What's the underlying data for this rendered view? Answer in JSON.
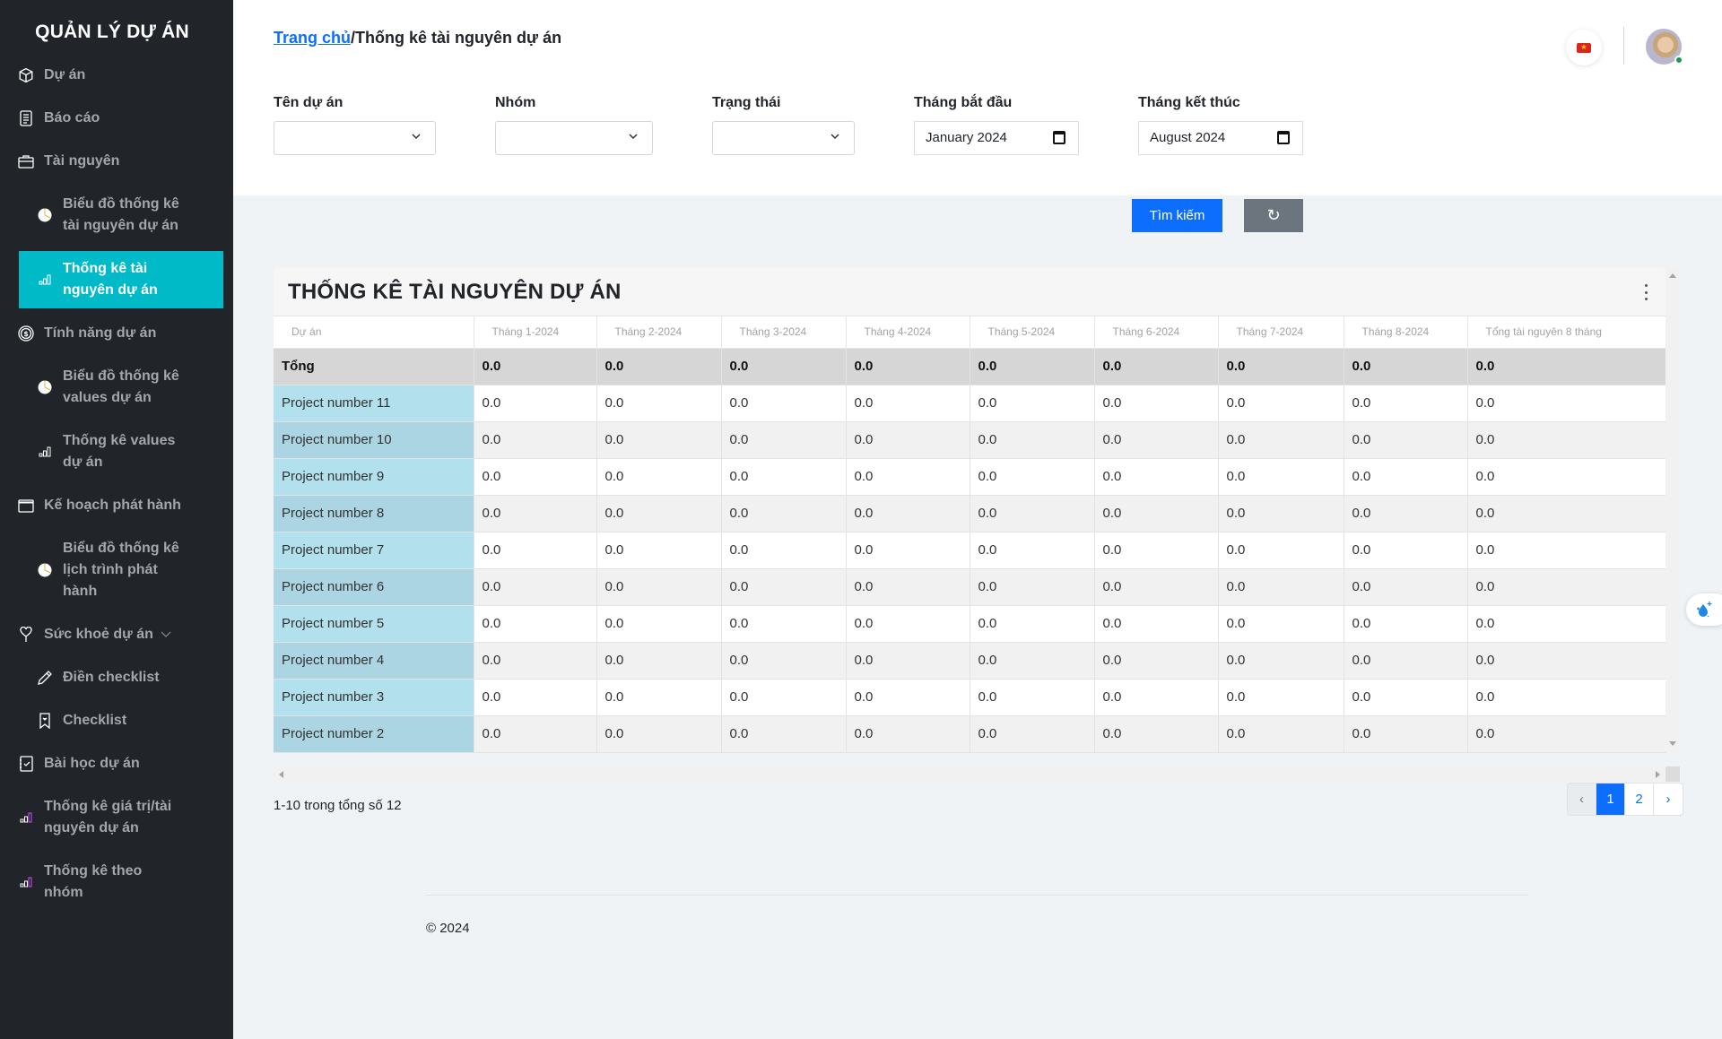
{
  "sidebar": {
    "brand": "QUẢN LÝ DỰ ÁN",
    "items": [
      {
        "label": "Dự án",
        "icon": "box-icon"
      },
      {
        "label": "Báo cáo",
        "icon": "document-icon"
      },
      {
        "label": "Tài nguyên",
        "icon": "briefcase-icon"
      },
      {
        "label": "Biểu đồ thống kê tài nguyên dự án",
        "line1": "Biểu đồ thống kê",
        "line2": "tài nguyên dự án",
        "icon": "pie-chart-icon"
      },
      {
        "label": "Thống kê tài nguyên dự án",
        "line1": "Thống kê tài",
        "line2": "nguyên dự án",
        "icon": "bar-chart-icon",
        "active": true
      },
      {
        "label": "Tính năng dự án",
        "icon": "coin-icon"
      },
      {
        "label": "Biểu đồ thống kê values dự án",
        "line1": "Biểu đồ thống kê",
        "line2": "values dự án",
        "icon": "pie-chart-icon"
      },
      {
        "label": "Thống kê values dự án",
        "line1": "Thống kê values",
        "line2": "dự án",
        "icon": "bar-chart-icon"
      },
      {
        "label": "Kế hoạch phát hành",
        "icon": "calendar-icon"
      },
      {
        "label": "Biểu đồ thống kê lịch trình phát hành",
        "line1": "Biểu đồ thống kê",
        "line2": "lịch trình phát",
        "line3": "hành",
        "icon": "pie-chart-icon"
      },
      {
        "label": "Sức khoẻ dự án",
        "icon": "heart-pin-icon",
        "expandable": true
      },
      {
        "label": "Điền checklist",
        "icon": "pencil-icon"
      },
      {
        "label": "Checklist",
        "icon": "bookmark-icon"
      },
      {
        "label": "Bài học dự án",
        "icon": "notebook-check-icon"
      },
      {
        "label": "Thống kê giá trị/tài nguyên dự án",
        "line1": "Thống kê giá trị/tài",
        "line2": "nguyên dự án",
        "icon": "bar-chart-icon"
      },
      {
        "label": "Thống kê theo nhóm",
        "line1": "Thống kê theo",
        "line2": "nhóm",
        "icon": "bar-chart-icon"
      }
    ]
  },
  "header": {
    "breadcrumb_home": "Trang chủ",
    "breadcrumb_sep": "/",
    "breadcrumb_current": "Thống kê tài nguyên dự án",
    "language": "vi",
    "flag_star": "★"
  },
  "filters": {
    "project_name_label": "Tên dự án",
    "project_name_value": "",
    "group_label": "Nhóm",
    "group_value": "",
    "status_label": "Trạng thái",
    "status_value": "",
    "start_month_label": "Tháng bắt đầu",
    "start_month_value": "January 2024",
    "end_month_label": "Tháng kết thúc",
    "end_month_value": "August 2024",
    "search_button": "Tìm kiếm",
    "reset_icon": "↻"
  },
  "table": {
    "title": "THỐNG KÊ TÀI NGUYÊN DỰ ÁN",
    "columns": [
      "Dự án",
      "Tháng 1-2024",
      "Tháng 2-2024",
      "Tháng 3-2024",
      "Tháng 4-2024",
      "Tháng 5-2024",
      "Tháng 6-2024",
      "Tháng 7-2024",
      "Tháng 8-2024",
      "Tổng tài nguyên 8 tháng"
    ],
    "total_row": [
      "Tổng",
      "0.0",
      "0.0",
      "0.0",
      "0.0",
      "0.0",
      "0.0",
      "0.0",
      "0.0",
      "0.0"
    ],
    "rows": [
      [
        "Project number 11",
        "0.0",
        "0.0",
        "0.0",
        "0.0",
        "0.0",
        "0.0",
        "0.0",
        "0.0",
        "0.0"
      ],
      [
        "Project number 10",
        "0.0",
        "0.0",
        "0.0",
        "0.0",
        "0.0",
        "0.0",
        "0.0",
        "0.0",
        "0.0"
      ],
      [
        "Project number 9",
        "0.0",
        "0.0",
        "0.0",
        "0.0",
        "0.0",
        "0.0",
        "0.0",
        "0.0",
        "0.0"
      ],
      [
        "Project number 8",
        "0.0",
        "0.0",
        "0.0",
        "0.0",
        "0.0",
        "0.0",
        "0.0",
        "0.0",
        "0.0"
      ],
      [
        "Project number 7",
        "0.0",
        "0.0",
        "0.0",
        "0.0",
        "0.0",
        "0.0",
        "0.0",
        "0.0",
        "0.0"
      ],
      [
        "Project number 6",
        "0.0",
        "0.0",
        "0.0",
        "0.0",
        "0.0",
        "0.0",
        "0.0",
        "0.0",
        "0.0"
      ],
      [
        "Project number 5",
        "0.0",
        "0.0",
        "0.0",
        "0.0",
        "0.0",
        "0.0",
        "0.0",
        "0.0",
        "0.0"
      ],
      [
        "Project number 4",
        "0.0",
        "0.0",
        "0.0",
        "0.0",
        "0.0",
        "0.0",
        "0.0",
        "0.0",
        "0.0"
      ],
      [
        "Project number 3",
        "0.0",
        "0.0",
        "0.0",
        "0.0",
        "0.0",
        "0.0",
        "0.0",
        "0.0",
        "0.0"
      ],
      [
        "Project number 2",
        "0.0",
        "0.0",
        "0.0",
        "0.0",
        "0.0",
        "0.0",
        "0.0",
        "0.0",
        "0.0"
      ]
    ]
  },
  "pagination": {
    "range_text": "1-10 trong tổng số 12",
    "prev": "‹",
    "pages": [
      "1",
      "2"
    ],
    "current_page": "1",
    "next": "›"
  },
  "footer": {
    "copyright": "© 2024"
  },
  "colors": {
    "sidebar_bg": "#212529",
    "active_item": "#00bac7",
    "primary": "#0d6efd",
    "secondary": "#6c757d",
    "name_cell": "#b2e0ec",
    "total_row": "#d6d6d6"
  }
}
